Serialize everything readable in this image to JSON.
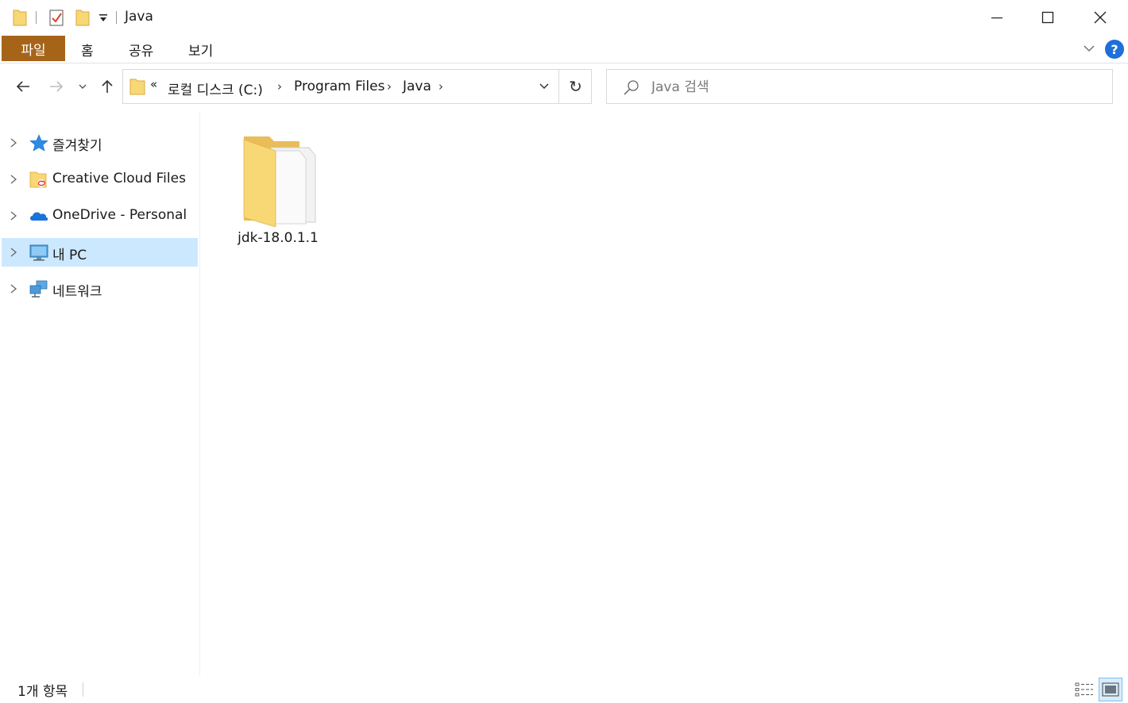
{
  "window": {
    "title": "Java"
  },
  "ribbon": {
    "tabs": [
      "파일",
      "홈",
      "공유",
      "보기"
    ],
    "help_label": "?"
  },
  "address": {
    "overflow": "«",
    "segments": [
      "로컬 디스크 (C:)",
      "Program Files",
      "Java"
    ]
  },
  "search": {
    "placeholder": "Java 검색"
  },
  "sidebar": {
    "items": [
      {
        "label": "즐겨찾기",
        "icon": "star-icon"
      },
      {
        "label": "Creative Cloud Files",
        "icon": "creative-cloud-folder-icon"
      },
      {
        "label": "OneDrive - Personal",
        "icon": "onedrive-cloud-icon"
      },
      {
        "label": "내 PC",
        "icon": "computer-icon",
        "selected": true
      },
      {
        "label": "네트워크",
        "icon": "network-icon"
      }
    ]
  },
  "content": {
    "items": [
      {
        "name": "jdk-18.0.1.1",
        "type": "folder"
      }
    ]
  },
  "status": {
    "count": "1개 항목"
  },
  "colors": {
    "file_tab": "#a66419",
    "selection": "#cce8ff",
    "accent": "#1e6fd9",
    "folder": "#f8d775"
  }
}
